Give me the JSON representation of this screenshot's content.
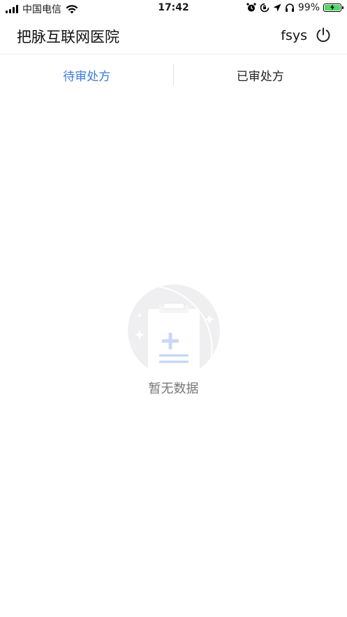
{
  "status_bar": {
    "carrier": "中国电信",
    "time": "17:42",
    "battery_percent": "99%",
    "battery_level": 0.99,
    "battery_color": "#4cd964"
  },
  "header": {
    "title": "把脉互联网医院",
    "username": "fsys",
    "logout_icon": "power-icon"
  },
  "tabs": [
    {
      "label": "待审处方",
      "active": true
    },
    {
      "label": "已审处方",
      "active": false
    }
  ],
  "empty_state": {
    "icon": "empty-clipboard-icon",
    "text": "暂无数据"
  },
  "colors": {
    "accent": "#3a7bd5",
    "text_primary": "#111111",
    "text_muted": "#777777",
    "divider": "#eeeeee"
  }
}
